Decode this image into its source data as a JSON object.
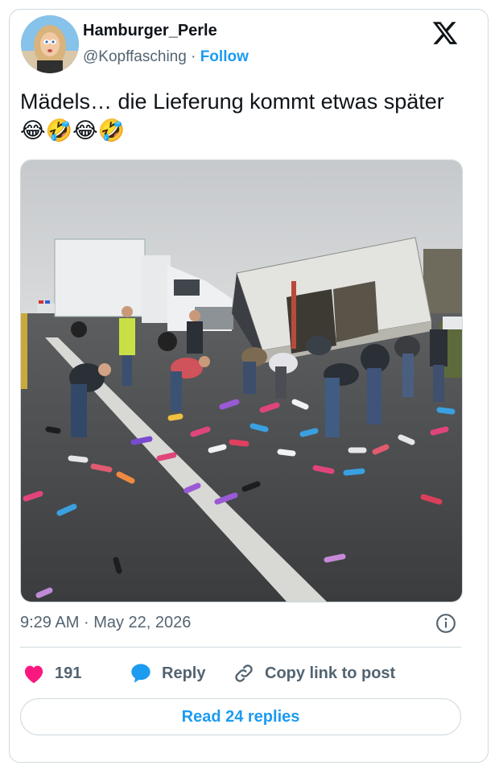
{
  "user": {
    "display_name": "Hamburger_Perle",
    "handle": "@Kopffasching",
    "separator": "·",
    "follow_label": "Follow",
    "avatar_icon": "profile-photo"
  },
  "tweet": {
    "text": "Mädels… die Lieferung kommt etwas später 😂🤣😂🤣",
    "media_icon": "photo-overturned-truck"
  },
  "meta": {
    "time": "9:29 AM",
    "separator": "·",
    "date": "May 22, 2026",
    "info_icon": "info-icon"
  },
  "actions": {
    "like_count": "191",
    "reply_label": "Reply",
    "copy_label": "Copy link to post"
  },
  "footer": {
    "read_replies_label": "Read 24 replies"
  },
  "colors": {
    "accent": "#1d9bf0",
    "like": "#f91880",
    "text": "#0f1419",
    "muted": "#536471",
    "border": "#cfd9de"
  }
}
